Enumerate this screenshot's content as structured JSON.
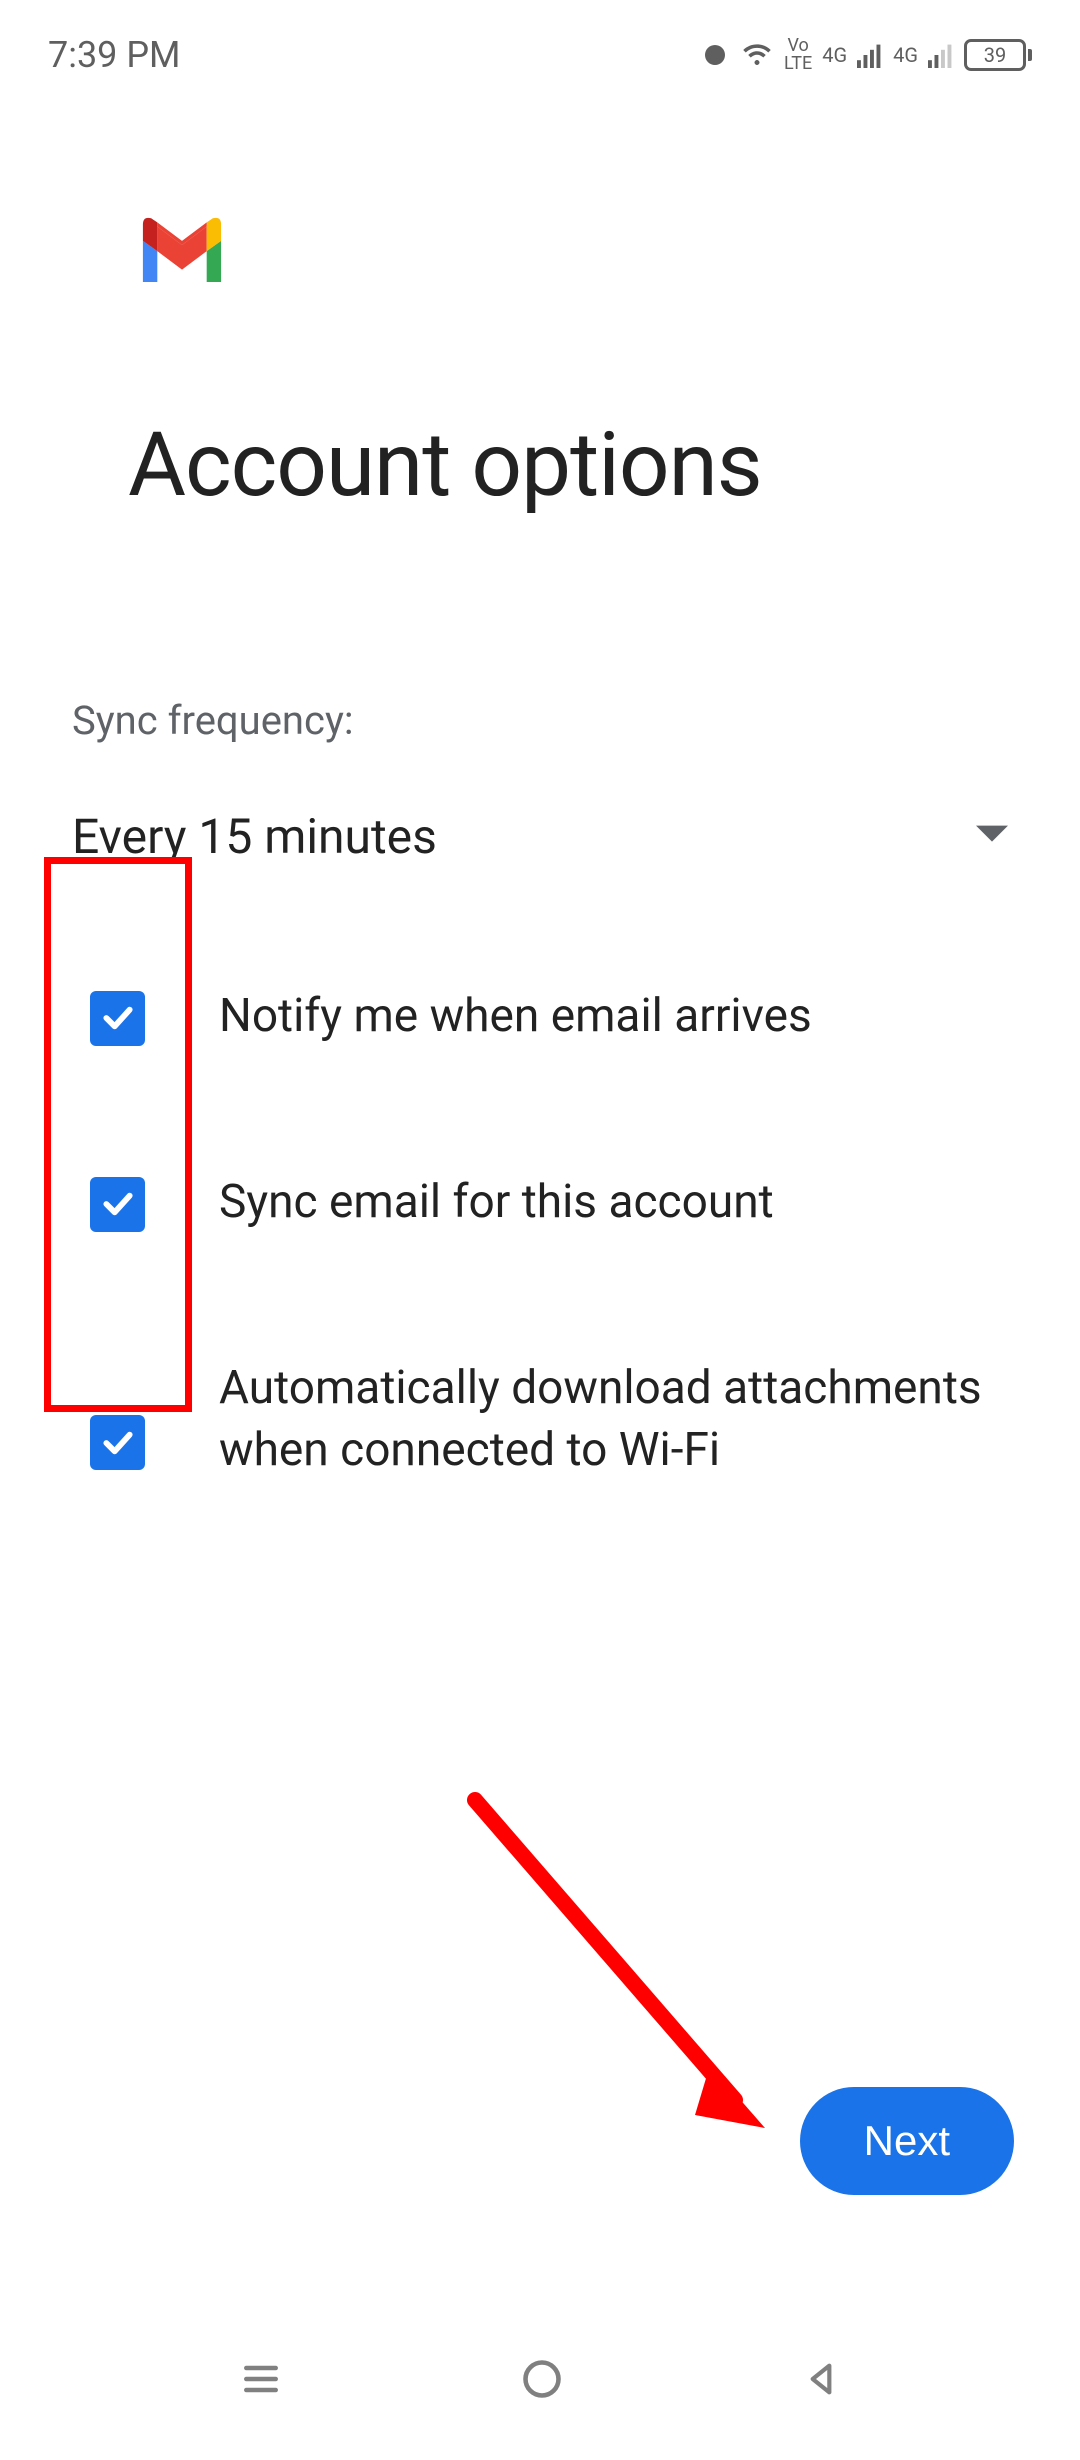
{
  "status": {
    "time": "7:39 PM",
    "volte_top": "Vo",
    "volte_bottom": "LTE",
    "net1": "4G",
    "net2": "4G",
    "battery": "39"
  },
  "page": {
    "title": "Account options",
    "sync_label": "Sync frequency:",
    "dropdown_value": "Every 15 minutes",
    "options": {
      "notify": "Notify me when email arrives",
      "sync": "Sync email for this account",
      "auto_download": "Automatically download attachments when connected to Wi-Fi"
    },
    "next_label": "Next"
  }
}
